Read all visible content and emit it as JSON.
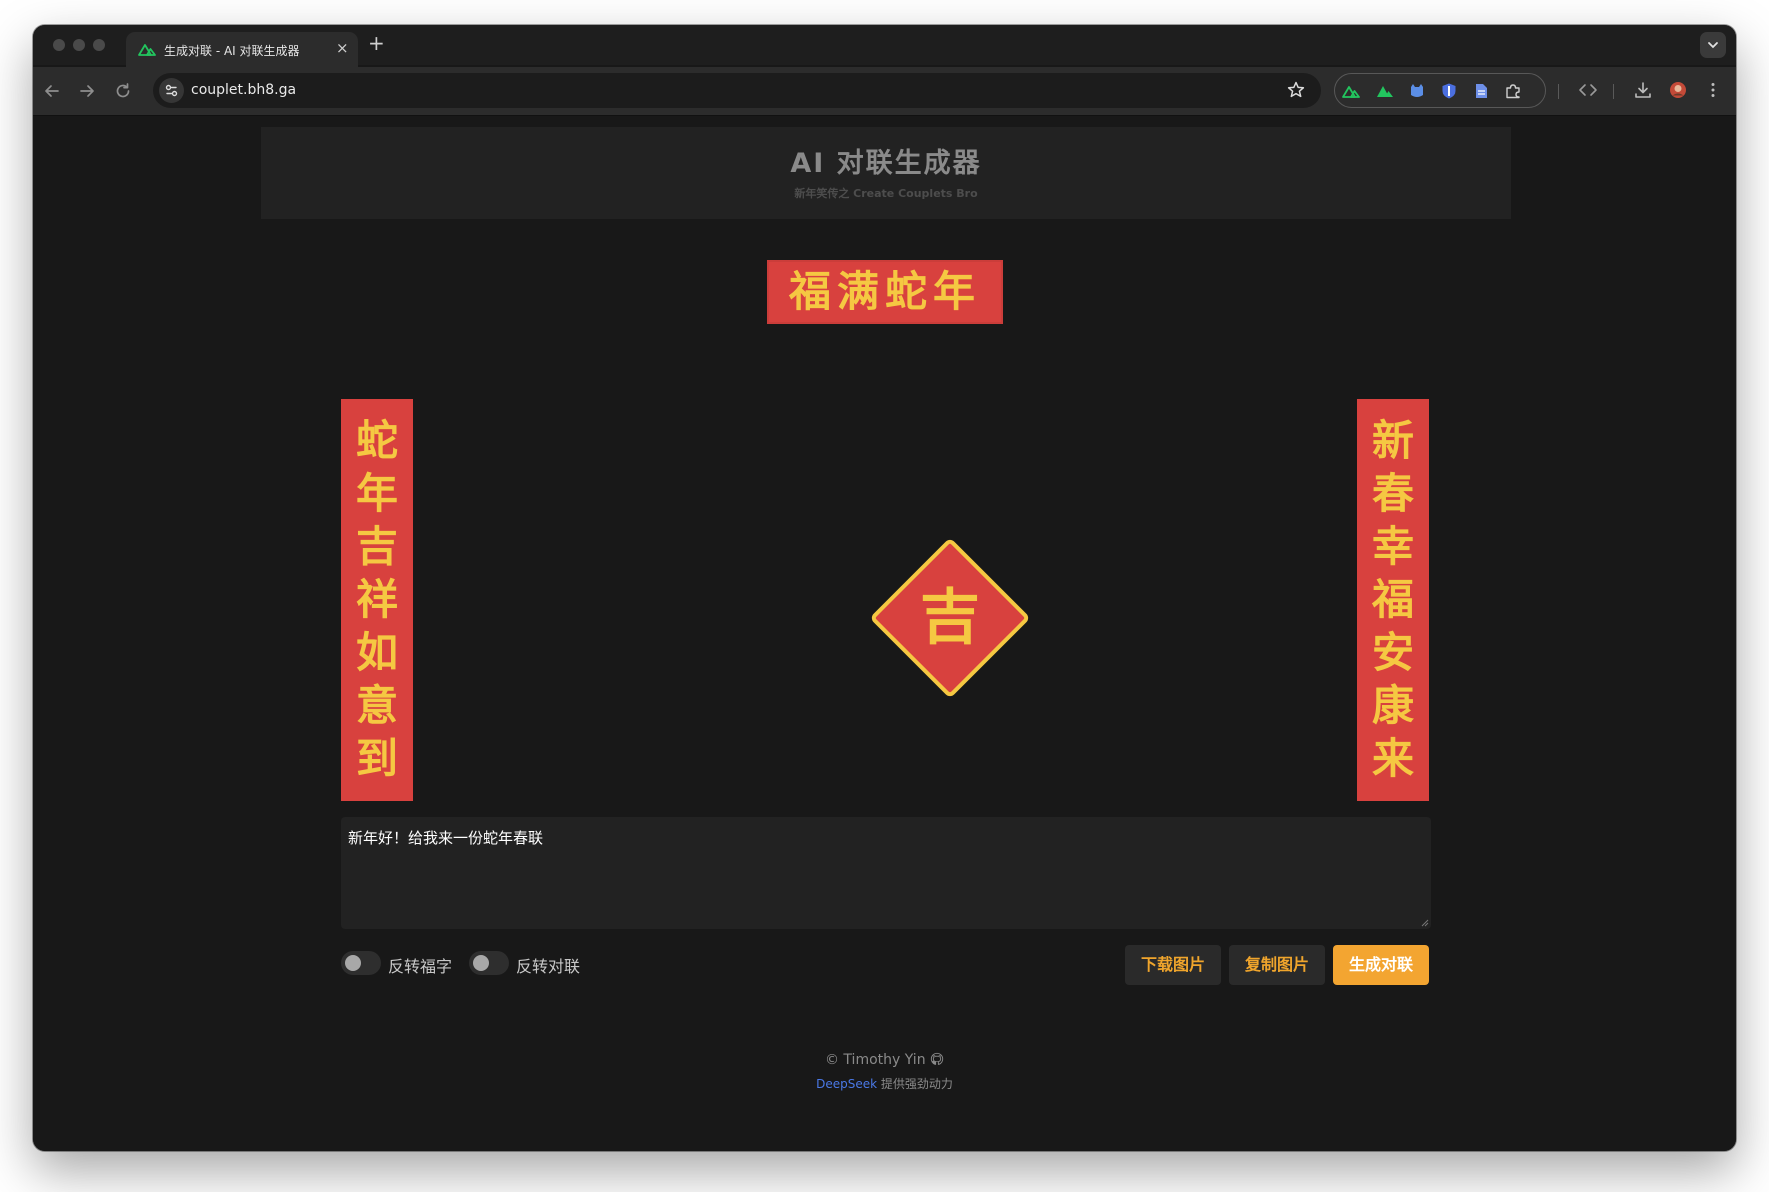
{
  "browser": {
    "tab_title": "生成对联 - AI 对联生成器",
    "tab_close": "×",
    "new_tab": "+",
    "url": "couplet.bh8.ga",
    "accent": "#22c55e"
  },
  "header": {
    "title": "AI 对联生成器",
    "subtitle": "新年笑传之 Create Couplets Bro"
  },
  "couplet": {
    "horizontal": "福满蛇年",
    "left": [
      "蛇",
      "年",
      "吉",
      "祥",
      "如",
      "意",
      "到"
    ],
    "right": [
      "新",
      "春",
      "幸",
      "福",
      "安",
      "康",
      "来"
    ],
    "center_char": "吉",
    "paper_color": "#d8413e",
    "ink_color": "#f5c842"
  },
  "prompt": {
    "value": "新年好！给我来一份蛇年春联"
  },
  "toggles": {
    "flip_fu": {
      "label": "反转福字",
      "on": false
    },
    "flip_couplet": {
      "label": "反转对联",
      "on": false
    }
  },
  "actions": {
    "download": "下载图片",
    "copy": "复制图片",
    "generate": "生成对联"
  },
  "footer": {
    "copyright": "© Timothy Yin",
    "powered_by_link": "DeepSeek",
    "powered_by_text": " 提供强劲动力"
  }
}
